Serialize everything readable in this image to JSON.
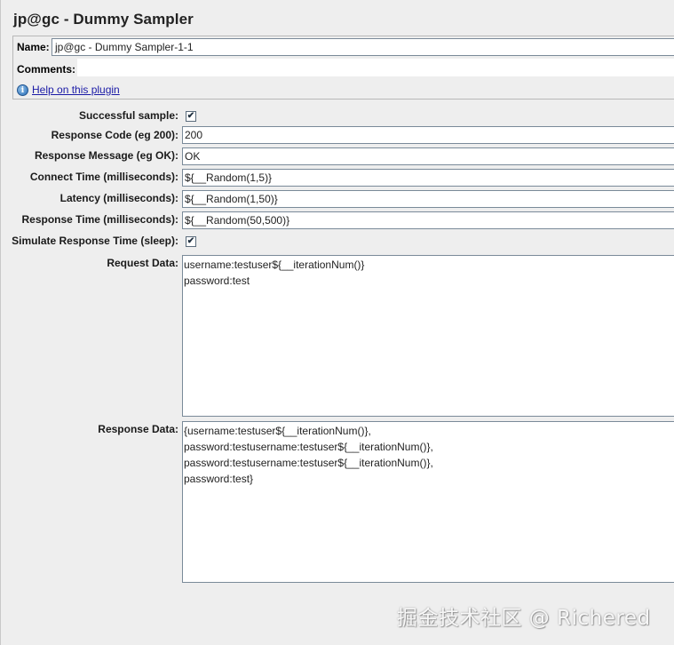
{
  "header": {
    "title": "jp@gc - Dummy Sampler"
  },
  "name_group": {
    "name_label": "Name:",
    "name_value": "jp@gc - Dummy Sampler-1-1",
    "comments_label": "Comments:",
    "help_link": "Help on this plugin",
    "help_icon": "info-icon"
  },
  "form": {
    "successful_sample": {
      "label": "Successful sample:",
      "checked": true
    },
    "response_code": {
      "label": "Response Code (eg 200):",
      "value": "200"
    },
    "response_message": {
      "label": "Response Message (eg OK):",
      "value": "OK"
    },
    "connect_time": {
      "label": "Connect Time (milliseconds):",
      "value": "${__Random(1,5)}"
    },
    "latency": {
      "label": "Latency (milliseconds):",
      "value": "${__Random(1,50)}"
    },
    "response_time": {
      "label": "Response Time (milliseconds):",
      "value": "${__Random(50,500)}"
    },
    "simulate_response_time": {
      "label": "Simulate Response Time (sleep):",
      "checked": true
    },
    "request_data": {
      "label": "Request Data:",
      "lines": [
        "username:testuser${__iterationNum()}",
        "password:test"
      ]
    },
    "response_data": {
      "label": "Response Data:",
      "lines": [
        "{username:testuser${__iterationNum()},",
        "password:testusername:testuser${__iterationNum()},",
        "password:testusername:testuser${__iterationNum()},",
        "password:test}"
      ]
    }
  },
  "watermark": "掘金技术社区 @ Richered"
}
